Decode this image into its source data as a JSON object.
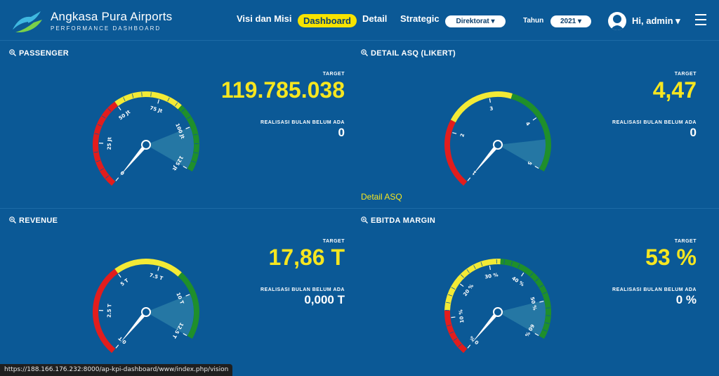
{
  "header": {
    "brand_title": "Angkasa Pura Airports",
    "brand_subtitle": "PERFORMANCE DASHBOARD",
    "nav": {
      "vision": "Visi dan Misi",
      "dashboard": "Dashboard",
      "detail": "Detail",
      "strategic": "Strategic"
    },
    "direktorat_label": "Direktorat ▾",
    "tahun_label": "Tahun",
    "tahun_value": "2021 ▾",
    "greeting": "Hi, admin ▾"
  },
  "colors": {
    "background": "#0b5996",
    "accent_yellow": "#f6e620",
    "gauge_red": "#e21d1d",
    "gauge_yellow": "#f3ea35",
    "gauge_green": "#1f8f2b"
  },
  "panels": {
    "passenger": {
      "title": "PASSENGER",
      "target_label": "TARGET",
      "target_value": "119.785.038",
      "real_label": "REALISASI BULAN BELUM ADA",
      "real_value": "0",
      "gauge_labels": [
        "0",
        "25 Jt",
        "50 Jt",
        "75 Jt",
        "100 Jt",
        "125 Jt"
      ],
      "needle_fraction": 0.0,
      "target_fraction": 0.8
    },
    "asq": {
      "title": "DETAIL ASQ (LIKERT)",
      "target_label": "TARGET",
      "target_value": "4,47",
      "real_label": "REALISASI BULAN BELUM ADA",
      "real_value": "0",
      "link": "Detail ASQ",
      "gauge_labels": [
        "1",
        "2",
        "3",
        "4",
        "5"
      ],
      "needle_fraction": 0.0,
      "target_fraction": 0.86
    },
    "revenue": {
      "title": "REVENUE",
      "target_label": "TARGET",
      "target_value": "17,86 T",
      "real_label": "REALISASI BULAN BELUM ADA",
      "real_value": "0,000 T",
      "gauge_labels": [
        "0 T",
        "2.5 T",
        "5 T",
        "7.5 T",
        "10 T",
        "12.5 T"
      ],
      "needle_fraction": 0.0,
      "target_fraction": 0.8
    },
    "ebitda": {
      "title": "EBITDA MARGIN",
      "target_label": "TARGET",
      "target_value": "53 %",
      "real_label": "REALISASI BULAN BELUM ADA",
      "real_value": "0 %",
      "gauge_labels": [
        "0 %",
        "10 %",
        "20 %",
        "30 %",
        "40 %",
        "50 %",
        "60 %"
      ],
      "needle_fraction": 0.0,
      "target_fraction": 0.83
    }
  },
  "status_url": "https://188.166.176.232:8000/ap-kpi-dashboard/www/index.php/vision"
}
